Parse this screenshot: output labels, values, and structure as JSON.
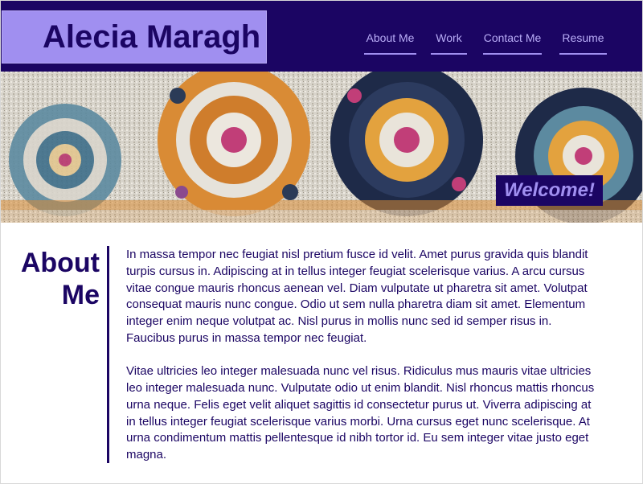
{
  "header": {
    "name": "Alecia Maragh",
    "nav": [
      {
        "label": "About Me"
      },
      {
        "label": "Work"
      },
      {
        "label": "Contact Me"
      },
      {
        "label": "Resume"
      }
    ]
  },
  "banner": {
    "welcome": "Welcome!",
    "image_subject": "patterned rug"
  },
  "about": {
    "title_line1": "About",
    "title_line2": "Me",
    "paragraphs": [
      "In massa tempor nec feugiat nisl pretium fusce id velit. Amet purus gravida quis blandit turpis cursus in. Adipiscing at in tellus integer feugiat scelerisque varius. A arcu cursus vitae congue mauris rhoncus aenean vel. Diam vulputate ut pharetra sit amet. Volutpat consequat mauris nunc congue. Odio ut sem nulla pharetra diam sit amet. Elementum integer enim neque volutpat ac. Nisl purus in mollis nunc sed id semper risus in. Faucibus purus in massa tempor nec feugiat.",
      "Vitae ultricies leo integer malesuada nunc vel risus. Ridiculus mus mauris vitae ultricies leo integer malesuada nunc. Vulputate odio ut enim blandit. Nisl rhoncus mattis rhoncus urna neque. Felis eget velit aliquet sagittis id consectetur purus ut. Viverra adipiscing at in tellus integer feugiat scelerisque varius morbi. Urna cursus eget nunc scelerisque. At urna condimentum mattis pellentesque id nibh tortor id. Eu sem integer vitae justo eget magna."
    ]
  },
  "colors": {
    "header_bg": "#1b0563",
    "accent": "#a08ff0",
    "text": "#1b0563"
  }
}
